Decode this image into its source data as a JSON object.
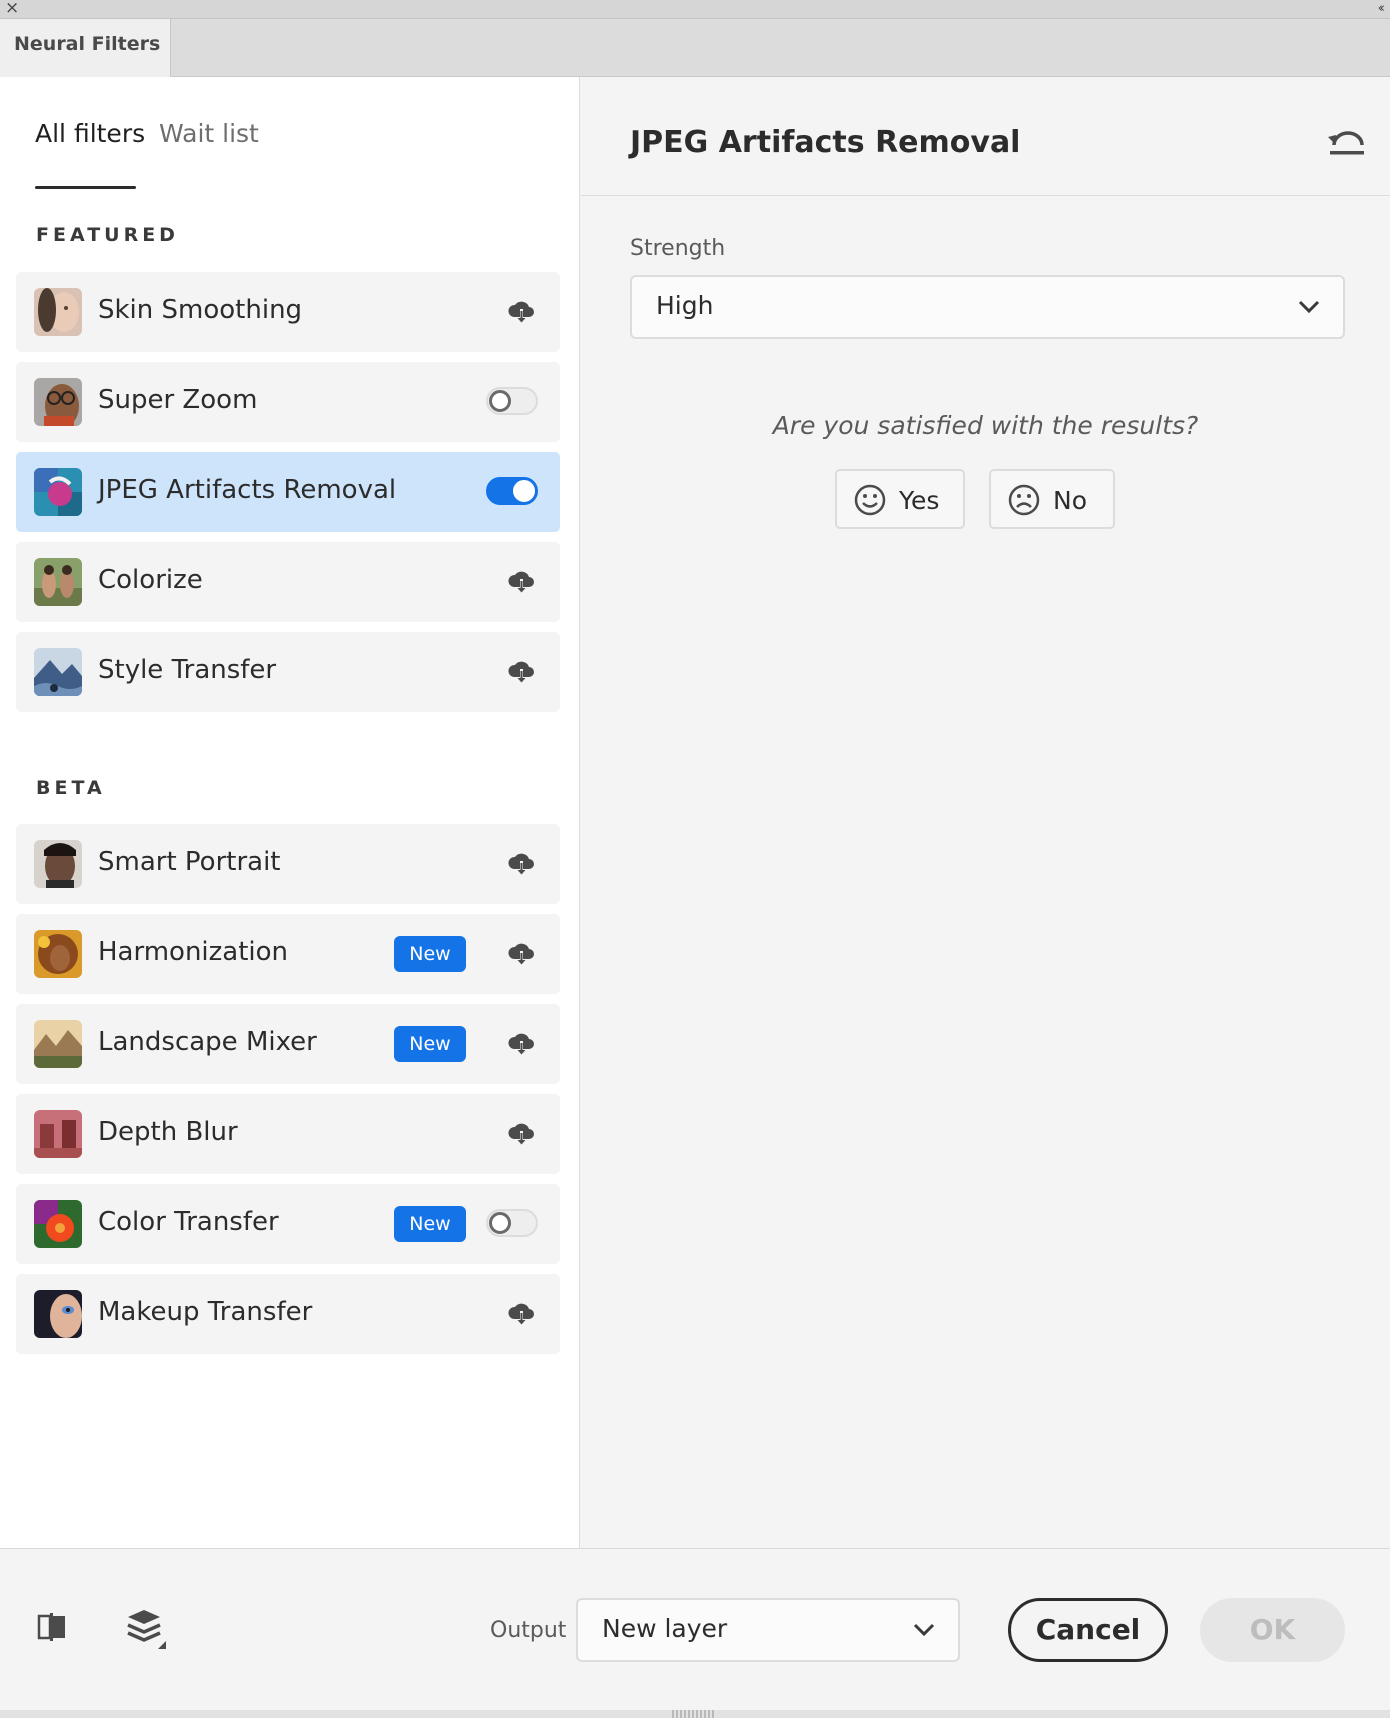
{
  "window": {
    "close_glyph": "×",
    "collapse_glyph": "‹‹",
    "panel_tab": "Neural Filters"
  },
  "filter_tabs": {
    "all": "All filters",
    "wait": "Wait list"
  },
  "sections": {
    "featured": "FEATURED",
    "beta": "BETA"
  },
  "featured": [
    {
      "label": "Skin Smoothing",
      "control": "cloud-download-icon"
    },
    {
      "label": "Super Zoom",
      "control": "toggle",
      "toggle_on": false
    },
    {
      "label": "JPEG Artifacts Removal",
      "control": "toggle",
      "toggle_on": true,
      "selected": true
    },
    {
      "label": "Colorize",
      "control": "cloud-download-icon"
    },
    {
      "label": "Style Transfer",
      "control": "cloud-download-icon"
    }
  ],
  "beta": [
    {
      "label": "Smart Portrait",
      "control": "cloud-download-icon"
    },
    {
      "label": "Harmonization",
      "badge": "New",
      "control": "cloud-download-icon"
    },
    {
      "label": "Landscape Mixer",
      "badge": "New",
      "control": "cloud-download-icon"
    },
    {
      "label": "Depth Blur",
      "control": "cloud-download-icon"
    },
    {
      "label": "Color Transfer",
      "badge": "New",
      "control": "toggle",
      "toggle_on": false
    },
    {
      "label": "Makeup Transfer",
      "control": "cloud-download-icon"
    }
  ],
  "detail": {
    "title": "JPEG Artifacts Removal",
    "strength_label": "Strength",
    "strength_value": "High",
    "question": "Are you satisfied with the results?",
    "yes": "Yes",
    "no": "No"
  },
  "footer": {
    "output_label": "Output",
    "output_value": "New layer",
    "cancel": "Cancel",
    "ok": "OK"
  },
  "colors": {
    "accent": "#1473e6",
    "selected_row": "#cde4fb"
  }
}
